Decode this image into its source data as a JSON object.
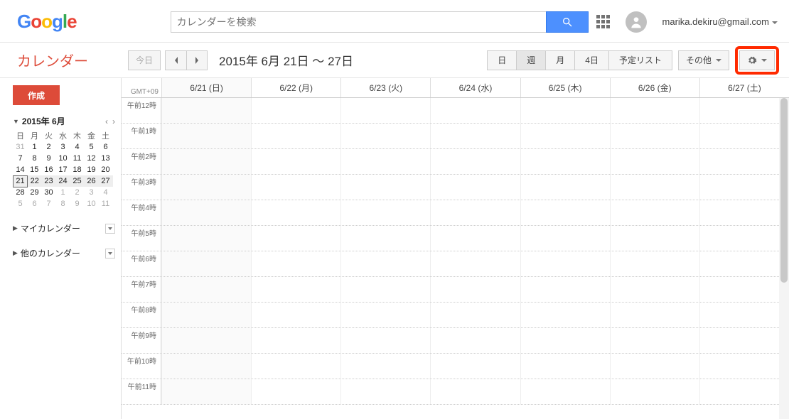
{
  "logo": [
    "G",
    "o",
    "o",
    "g",
    "l",
    "e"
  ],
  "search": {
    "placeholder": "カレンダーを検索"
  },
  "user": {
    "email": "marika.dekiru@gmail.com"
  },
  "app_title": "カレンダー",
  "toolbar": {
    "today": "今日",
    "range": "2015年 6月 21日 ～ 27日",
    "views": [
      {
        "label": "日",
        "active": false
      },
      {
        "label": "週",
        "active": true
      },
      {
        "label": "月",
        "active": false
      },
      {
        "label": "4日",
        "active": false
      },
      {
        "label": "予定リスト",
        "active": false
      }
    ],
    "other": "その他"
  },
  "sidebar": {
    "create": "作成",
    "minical": {
      "title": "2015年 6月",
      "dow": [
        "日",
        "月",
        "火",
        "水",
        "木",
        "金",
        "土"
      ],
      "weeks": [
        [
          {
            "d": "31",
            "o": true
          },
          {
            "d": "1"
          },
          {
            "d": "2"
          },
          {
            "d": "3"
          },
          {
            "d": "4"
          },
          {
            "d": "5"
          },
          {
            "d": "6"
          }
        ],
        [
          {
            "d": "7"
          },
          {
            "d": "8"
          },
          {
            "d": "9"
          },
          {
            "d": "10"
          },
          {
            "d": "11"
          },
          {
            "d": "12"
          },
          {
            "d": "13"
          }
        ],
        [
          {
            "d": "14"
          },
          {
            "d": "15"
          },
          {
            "d": "16"
          },
          {
            "d": "17"
          },
          {
            "d": "18"
          },
          {
            "d": "19"
          },
          {
            "d": "20"
          }
        ],
        [
          {
            "d": "21",
            "sel": true
          },
          {
            "d": "22"
          },
          {
            "d": "23"
          },
          {
            "d": "24"
          },
          {
            "d": "25"
          },
          {
            "d": "26"
          },
          {
            "d": "27"
          }
        ],
        [
          {
            "d": "28"
          },
          {
            "d": "29"
          },
          {
            "d": "30"
          },
          {
            "d": "1",
            "o": true
          },
          {
            "d": "2",
            "o": true
          },
          {
            "d": "3",
            "o": true
          },
          {
            "d": "4",
            "o": true
          }
        ],
        [
          {
            "d": "5",
            "o": true
          },
          {
            "d": "6",
            "o": true
          },
          {
            "d": "7",
            "o": true
          },
          {
            "d": "8",
            "o": true
          },
          {
            "d": "9",
            "o": true
          },
          {
            "d": "10",
            "o": true
          },
          {
            "d": "11",
            "o": true
          }
        ]
      ],
      "hl_week": 3
    },
    "sections": [
      "マイカレンダー",
      "他のカレンダー"
    ]
  },
  "grid": {
    "tz": "GMT+09",
    "days": [
      "6/21 (日)",
      "6/22 (月)",
      "6/23 (火)",
      "6/24 (水)",
      "6/25 (木)",
      "6/26 (金)",
      "6/27 (土)"
    ],
    "sel_col": 0,
    "hours": [
      "午前12時",
      "午前1時",
      "午前2時",
      "午前3時",
      "午前4時",
      "午前5時",
      "午前6時",
      "午前7時",
      "午前8時",
      "午前9時",
      "午前10時",
      "午前11時"
    ]
  }
}
